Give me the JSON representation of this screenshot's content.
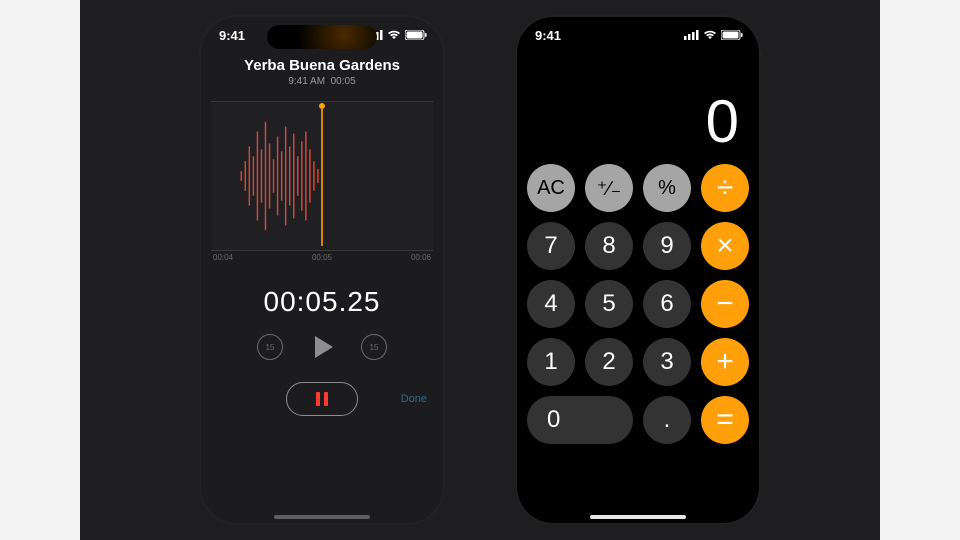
{
  "status": {
    "time": "9:41"
  },
  "voice_memos": {
    "title": "Yerba Buena Gardens",
    "subtitle_time": "9:41 AM",
    "subtitle_duration": "00:05",
    "ticks": [
      "00:04",
      "00:05",
      "00:06"
    ],
    "timer": "00:05.25",
    "seek_back_label": "15",
    "seek_fwd_label": "15",
    "done_label": "Done"
  },
  "calculator": {
    "display": "0",
    "buttons": [
      {
        "label": "AC",
        "kind": "light",
        "name": "clear-button"
      },
      {
        "label": "⁺∕₋",
        "kind": "light",
        "name": "sign-button"
      },
      {
        "label": "%",
        "kind": "light",
        "name": "percent-button"
      },
      {
        "label": "÷",
        "kind": "op",
        "name": "divide-button"
      },
      {
        "label": "7",
        "kind": "dark",
        "name": "digit-7-button"
      },
      {
        "label": "8",
        "kind": "dark",
        "name": "digit-8-button"
      },
      {
        "label": "9",
        "kind": "dark",
        "name": "digit-9-button"
      },
      {
        "label": "×",
        "kind": "op",
        "name": "multiply-button"
      },
      {
        "label": "4",
        "kind": "dark",
        "name": "digit-4-button"
      },
      {
        "label": "5",
        "kind": "dark",
        "name": "digit-5-button"
      },
      {
        "label": "6",
        "kind": "dark",
        "name": "digit-6-button"
      },
      {
        "label": "−",
        "kind": "op",
        "name": "minus-button"
      },
      {
        "label": "1",
        "kind": "dark",
        "name": "digit-1-button"
      },
      {
        "label": "2",
        "kind": "dark",
        "name": "digit-2-button"
      },
      {
        "label": "3",
        "kind": "dark",
        "name": "digit-3-button"
      },
      {
        "label": "+",
        "kind": "op",
        "name": "plus-button"
      },
      {
        "label": "0",
        "kind": "dark zero",
        "name": "digit-0-button"
      },
      {
        "label": ".",
        "kind": "dark",
        "name": "decimal-button"
      },
      {
        "label": "=",
        "kind": "op",
        "name": "equals-button"
      }
    ]
  }
}
